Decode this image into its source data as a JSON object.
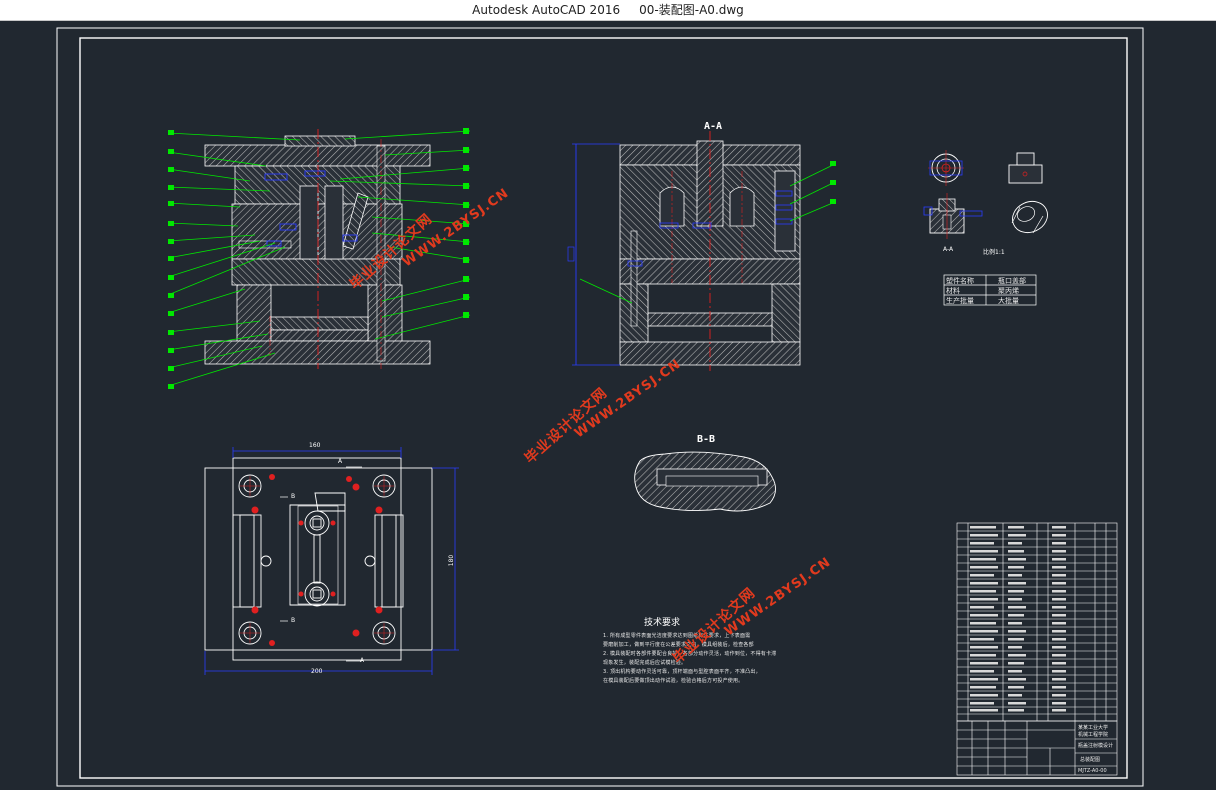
{
  "window": {
    "title": "Autodesk AutoCAD 2016     00-装配图-A0.dwg"
  },
  "drawing": {
    "section_aa": "A-A",
    "section_bb": "B-B",
    "part_scale": "比例1:1",
    "part_view_label": "A-A",
    "view_markers": {
      "a_top": "A",
      "a_bottom": "A",
      "b_top": "B",
      "b_bottom": "B"
    },
    "dims": {
      "top_width": "160",
      "bottom_width": "200",
      "right_height": "180"
    },
    "part_props": [
      {
        "key": "塑件名称",
        "value": "瓶口盖部"
      },
      {
        "key": "材料",
        "value": "聚丙烯"
      },
      {
        "key": "生产批量",
        "value": "大批量"
      }
    ],
    "tech_req": {
      "title": "技术要求",
      "lines": [
        "1. 所有成型零件表面光洁度要求达到图纸标注要求，上下表面需",
        "要磨削加工，做到平行度在公差要求之内，模具组装后，检查各部",
        "2. 模具装配时各部件要配合良好，各部分动作灵活，动作到位，不得有卡滞",
        "现象发生，装配完成后应试模检验。",
        "3. 顶出机构要动作灵活可靠，顶杆端面与型腔表面平齐，不准凸出，",
        "在模具装配后要做顶出动作试验，检验合格后方可投产使用。"
      ]
    },
    "title_block": {
      "school": "某某工业大学",
      "department": "机械工程学院",
      "drawing_name": "瓶盖注射模设计",
      "sheet_name": "总装配图",
      "drawing_no": "MJTZ-A0-00"
    },
    "watermarks": [
      {
        "line1": "毕业设计论文网",
        "line2": "WWW.2BYSJ.CN"
      },
      {
        "line1": "毕业设计论文网",
        "line2": "WWW.2BYSJ.CN"
      },
      {
        "line1": "毕业设计论文网",
        "line2": "WWW.2BYSJ.CN"
      }
    ]
  },
  "colors": {
    "background": "#212830",
    "leader": "#00e800",
    "hatch": "#c8c8c8",
    "centerline": "#e02020",
    "dimension": "#2a3cff",
    "border": "#ffffff"
  }
}
